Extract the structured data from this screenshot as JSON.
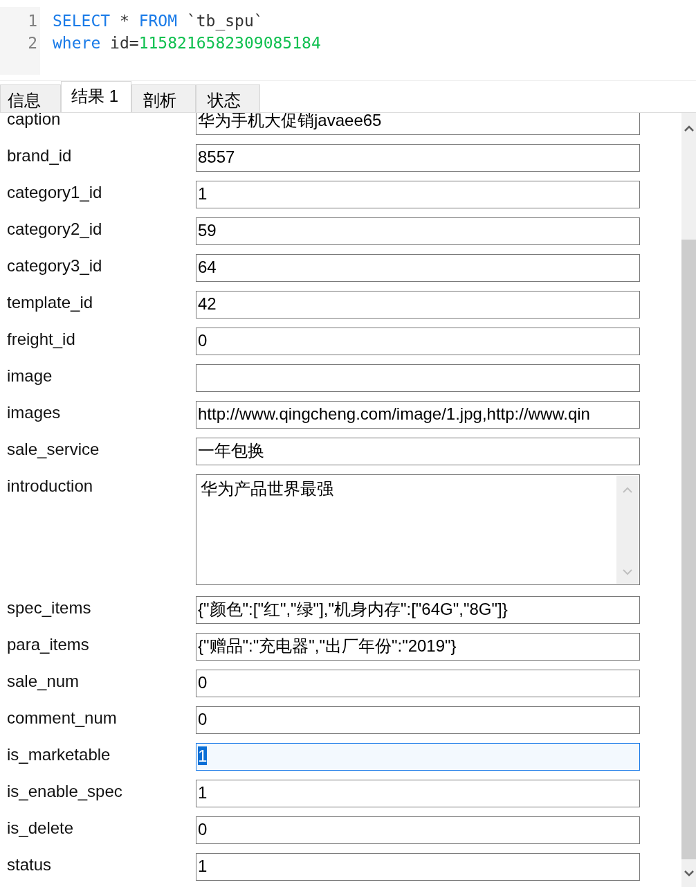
{
  "editor": {
    "lines": [
      {
        "number": "1",
        "tokens": [
          {
            "kind": "keyword",
            "text": "SELECT"
          },
          {
            "kind": "plain",
            "text": " * "
          },
          {
            "kind": "keyword",
            "text": "FROM"
          },
          {
            "kind": "plain",
            "text": " `tb_spu`"
          }
        ]
      },
      {
        "number": "2",
        "tokens": [
          {
            "kind": "keyword",
            "text": "where"
          },
          {
            "kind": "plain",
            "text": " id="
          },
          {
            "kind": "number",
            "text": "1158216582309085184"
          }
        ]
      }
    ]
  },
  "tabs": [
    {
      "label": "信息",
      "selected": false
    },
    {
      "label": "结果 1",
      "selected": true
    },
    {
      "label": "剖析",
      "selected": false
    },
    {
      "label": "状态",
      "selected": false
    }
  ],
  "fields": [
    {
      "label": "caption",
      "kind": "text",
      "value": "华为手机大促销javaee65",
      "selected": false
    },
    {
      "label": "brand_id",
      "kind": "text",
      "value": "8557",
      "selected": false
    },
    {
      "label": "category1_id",
      "kind": "text",
      "value": "1",
      "selected": false
    },
    {
      "label": "category2_id",
      "kind": "text",
      "value": "59",
      "selected": false
    },
    {
      "label": "category3_id",
      "kind": "text",
      "value": "64",
      "selected": false
    },
    {
      "label": "template_id",
      "kind": "text",
      "value": "42",
      "selected": false
    },
    {
      "label": "freight_id",
      "kind": "text",
      "value": "0",
      "selected": false
    },
    {
      "label": "image",
      "kind": "text",
      "selected": false
    },
    {
      "label": "images",
      "kind": "text",
      "value": "http://www.qingcheng.com/image/1.jpg,http://www.qin",
      "selected": false
    },
    {
      "label": "sale_service",
      "kind": "text",
      "value": "一年包换",
      "selected": false
    },
    {
      "label": "introduction",
      "kind": "textarea",
      "value": "华为产品世界最强",
      "selected": false
    },
    {
      "label": "spec_items",
      "kind": "text",
      "value": "{\"颜色\":[\"红\",\"绿\"],\"机身内存\":[\"64G\",\"8G\"]}",
      "selected": false
    },
    {
      "label": "para_items",
      "kind": "text",
      "value": "{\"赠品\":\"充电器\",\"出厂年份\":\"2019\"}",
      "selected": false
    },
    {
      "label": "sale_num",
      "kind": "text",
      "value": "0",
      "selected": false
    },
    {
      "label": "comment_num",
      "kind": "text",
      "value": "0",
      "selected": false
    },
    {
      "label": "is_marketable",
      "kind": "text",
      "value": "1",
      "selected": true
    },
    {
      "label": "is_enable_spec",
      "kind": "text",
      "value": "1",
      "selected": false
    },
    {
      "label": "is_delete",
      "kind": "text",
      "value": "0",
      "selected": false
    },
    {
      "label": "status",
      "kind": "text",
      "value": "1",
      "selected": false
    }
  ]
}
